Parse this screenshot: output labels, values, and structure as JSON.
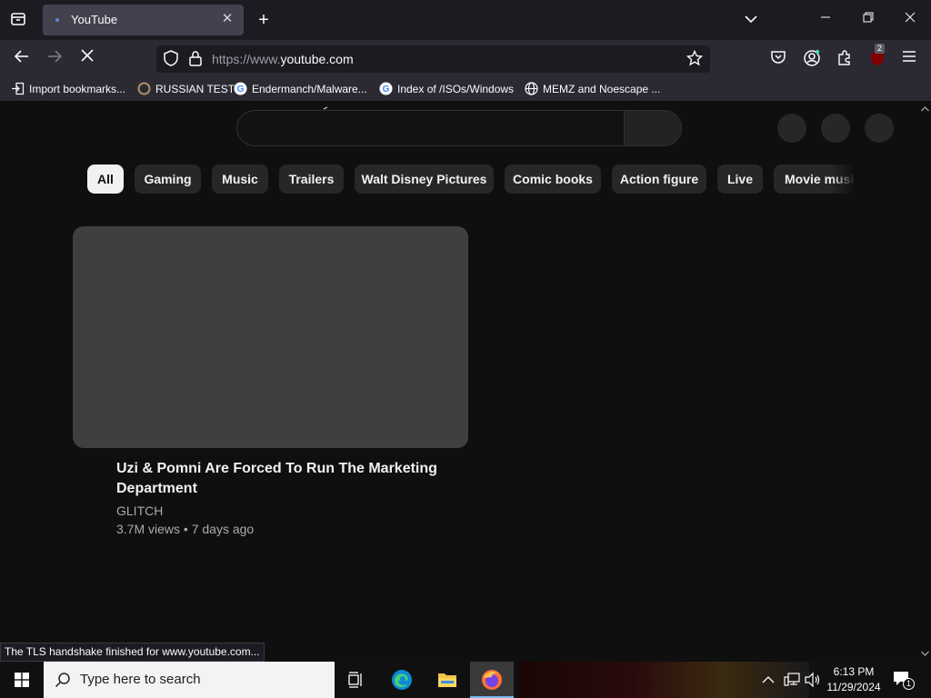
{
  "browser": {
    "tab_title": "YouTube",
    "url_prefix": "https://www.",
    "url_domain": "youtube.com",
    "extension_badge": "2",
    "bookmarks": [
      {
        "label": "Import bookmarks..."
      },
      {
        "label": "RUSSIAN TEST"
      },
      {
        "label": "Endermanch/Malware..."
      },
      {
        "label": "Index of /ISOs/Windows"
      },
      {
        "label": "MEMZ and Noescape ..."
      }
    ],
    "status_text": "The TLS handshake finished for www.youtube.com..."
  },
  "youtube": {
    "chips": [
      {
        "label": "All",
        "active": true
      },
      {
        "label": "Gaming"
      },
      {
        "label": "Music"
      },
      {
        "label": "Trailers"
      },
      {
        "label": "Walt Disney Pictures"
      },
      {
        "label": "Comic books"
      },
      {
        "label": "Action figure"
      },
      {
        "label": "Live"
      },
      {
        "label": "Movie music"
      }
    ],
    "video": {
      "title": "Uzi & Pomni Are Forced To Run The Marketing Department",
      "channel": "GLITCH",
      "meta": "3.7M views • 7 days ago"
    }
  },
  "taskbar": {
    "search_placeholder": "Type here to search",
    "time": "6:13 PM",
    "date": "11/29/2024",
    "notification_count": "1"
  },
  "colors": {
    "youtube_bg": "#0f0f0f",
    "chip_bg": "#272727",
    "chip_active_bg": "#f1f1f1",
    "browser_tabbar": "#1c1b22",
    "browser_toolbar": "#2b2a33"
  }
}
